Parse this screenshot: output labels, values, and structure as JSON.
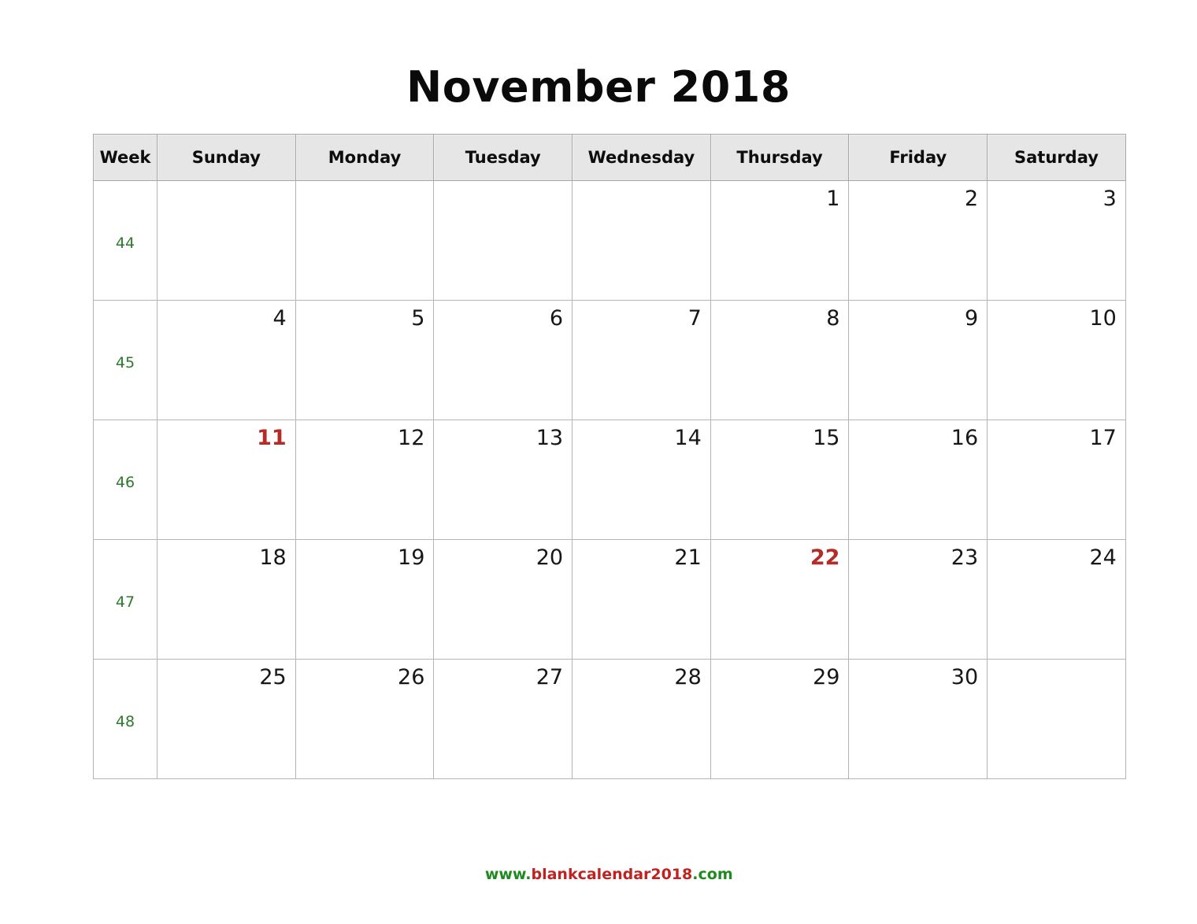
{
  "title": "November 2018",
  "month": "November",
  "year": "2018",
  "colors": {
    "week_number": "#2d7a2d",
    "highlight_day": "#b52b27",
    "header_background": "#e6e6e6",
    "grid_border": "#b4b4b4",
    "footer_green": "#1f8a1f",
    "footer_red": "#c0231f"
  },
  "header": {
    "week_label": "Week",
    "days": [
      "Sunday",
      "Monday",
      "Tuesday",
      "Wednesday",
      "Thursday",
      "Friday",
      "Saturday"
    ]
  },
  "weeks": [
    {
      "week_number": "44",
      "days": [
        {
          "label": "",
          "highlight": false
        },
        {
          "label": "",
          "highlight": false
        },
        {
          "label": "",
          "highlight": false
        },
        {
          "label": "",
          "highlight": false
        },
        {
          "label": "1",
          "highlight": false
        },
        {
          "label": "2",
          "highlight": false
        },
        {
          "label": "3",
          "highlight": false
        }
      ]
    },
    {
      "week_number": "45",
      "days": [
        {
          "label": "4",
          "highlight": false
        },
        {
          "label": "5",
          "highlight": false
        },
        {
          "label": "6",
          "highlight": false
        },
        {
          "label": "7",
          "highlight": false
        },
        {
          "label": "8",
          "highlight": false
        },
        {
          "label": "9",
          "highlight": false
        },
        {
          "label": "10",
          "highlight": false
        }
      ]
    },
    {
      "week_number": "46",
      "days": [
        {
          "label": "11",
          "highlight": true
        },
        {
          "label": "12",
          "highlight": false
        },
        {
          "label": "13",
          "highlight": false
        },
        {
          "label": "14",
          "highlight": false
        },
        {
          "label": "15",
          "highlight": false
        },
        {
          "label": "16",
          "highlight": false
        },
        {
          "label": "17",
          "highlight": false
        }
      ]
    },
    {
      "week_number": "47",
      "days": [
        {
          "label": "18",
          "highlight": false
        },
        {
          "label": "19",
          "highlight": false
        },
        {
          "label": "20",
          "highlight": false
        },
        {
          "label": "21",
          "highlight": false
        },
        {
          "label": "22",
          "highlight": true
        },
        {
          "label": "23",
          "highlight": false
        },
        {
          "label": "24",
          "highlight": false
        }
      ]
    },
    {
      "week_number": "48",
      "days": [
        {
          "label": "25",
          "highlight": false
        },
        {
          "label": "26",
          "highlight": false
        },
        {
          "label": "27",
          "highlight": false
        },
        {
          "label": "28",
          "highlight": false
        },
        {
          "label": "29",
          "highlight": false
        },
        {
          "label": "30",
          "highlight": false
        },
        {
          "label": "",
          "highlight": false
        }
      ]
    }
  ],
  "footer": {
    "prefix": "www.",
    "domain": "blankcalendar2018",
    "suffix": ".com",
    "full": "www.blankcalendar2018.com"
  }
}
